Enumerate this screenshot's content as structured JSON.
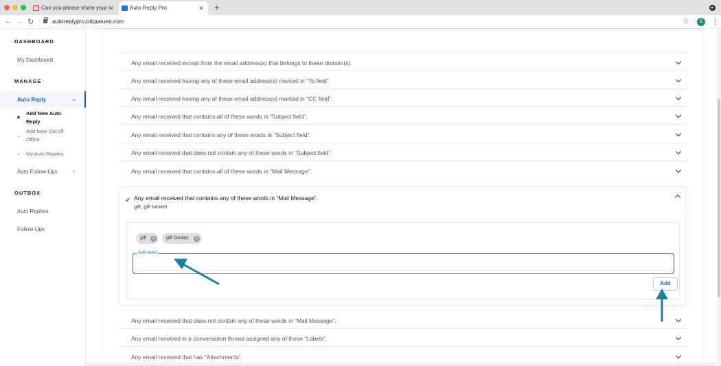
{
  "browser": {
    "tabs": [
      {
        "title": "Can you please share your me"
      },
      {
        "title": "Auto Reply Pro"
      }
    ],
    "url": "autoreplypro.bitqueues.com",
    "profile_initial": "C"
  },
  "sidebar": {
    "dashboard_heading": "DASHBOARD",
    "my_dashboard": "My Dashboard",
    "manage_heading": "MANAGE",
    "auto_reply": "Auto Reply",
    "sub_items": [
      "Add New Auto Reply",
      "Add New Out Of Office",
      "My Auto Replies"
    ],
    "auto_follow_ups": "Auto Follow-Ups",
    "outbox_heading": "OUTBOX",
    "outbox_items": [
      "Auto Replies",
      "Follow-Ups"
    ]
  },
  "rules": {
    "partial_top": "Any email received except from the email address(s) that belongs to these domain(s).",
    "items_above": [
      "Any email received having any of these email address(s) marked in “To field”.",
      "Any email received having any of these email address(s) marked in “CC field”.",
      "Any email received that contains all of these words in “Subject field”.",
      "Any email received that contains any of these words in “Subject field”.",
      "Any email received that does not contain any of these words in “Subject field”.",
      "Any email received that contains all of these words in “Mail Message”."
    ],
    "expanded": {
      "title": "Any email received that contains any of these words in “Mail Message”.",
      "subtitle": "gift, gift basket",
      "chips": [
        "gift",
        "gift basket"
      ],
      "input_label": "Add word",
      "input_value": "",
      "add_button": "Add"
    },
    "items_below": [
      "Any email received that does not contain any of these words in “Mail Message”.",
      "Any email received in a conversation thread assigned any of these “Labels”.",
      "Any email received that has “Attachments”."
    ]
  },
  "colors": {
    "accent": "#1565c0",
    "check": "#2e9a46",
    "annotation_arrow": "#1e7fa0"
  }
}
